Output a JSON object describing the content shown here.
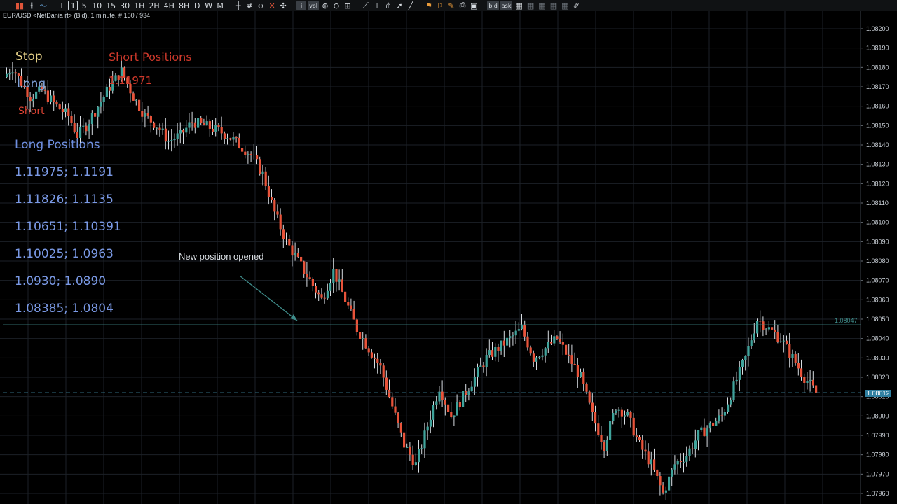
{
  "toolbar": {
    "group1": [
      {
        "name": "candlestick-icon",
        "glyph": "▮▮",
        "cls": "red"
      },
      {
        "name": "bar-chart-icon",
        "glyph": "⫲",
        "cls": ""
      },
      {
        "name": "line-chart-icon",
        "glyph": "〜",
        "cls": "blue"
      }
    ],
    "timeframes": [
      "T",
      "1",
      "5",
      "10",
      "15",
      "30",
      "1H",
      "2H",
      "4H",
      "8H",
      "D",
      "W",
      "M"
    ],
    "selected_timeframe": "1",
    "group2": [
      {
        "name": "crosshair-icon",
        "glyph": "┼",
        "cls": ""
      },
      {
        "name": "grid-icon",
        "glyph": "#",
        "cls": ""
      },
      {
        "name": "arrows-icon",
        "glyph": "↔",
        "cls": ""
      },
      {
        "name": "delete-icon",
        "glyph": "✕",
        "cls": "red"
      },
      {
        "name": "move-icon",
        "glyph": "✣",
        "cls": ""
      },
      {
        "name": "info-icon",
        "glyph": "i",
        "cls": "box"
      },
      {
        "name": "volume-icon",
        "glyph": "vol",
        "cls": "box"
      },
      {
        "name": "zoom-in-icon",
        "glyph": "⊕",
        "cls": ""
      },
      {
        "name": "zoom-out-icon",
        "glyph": "⊖",
        "cls": ""
      },
      {
        "name": "fit-icon",
        "glyph": "⊞",
        "cls": ""
      },
      {
        "name": "trend-tool-icon",
        "glyph": "⟋",
        "cls": ""
      },
      {
        "name": "fibonacci-icon",
        "glyph": "⊥",
        "cls": ""
      },
      {
        "name": "channel-icon",
        "glyph": "⫛",
        "cls": ""
      },
      {
        "name": "pointer-icon",
        "glyph": "➚",
        "cls": ""
      },
      {
        "name": "draw-line-icon",
        "glyph": "╱",
        "cls": ""
      },
      {
        "name": "flag-icon",
        "glyph": "⚑",
        "cls": "orange"
      },
      {
        "name": "marker-icon",
        "glyph": "⚐",
        "cls": "orange"
      },
      {
        "name": "pencil-icon",
        "glyph": "✎",
        "cls": "orange"
      },
      {
        "name": "print-icon",
        "glyph": "⎙",
        "cls": ""
      },
      {
        "name": "image-icon",
        "glyph": "▣",
        "cls": ""
      },
      {
        "name": "bid-icon",
        "glyph": "bid",
        "cls": "box"
      },
      {
        "name": "ask-icon",
        "glyph": "ask",
        "cls": "box"
      },
      {
        "name": "layout1-icon",
        "glyph": "▦",
        "cls": ""
      },
      {
        "name": "layout2-icon",
        "glyph": "▦",
        "cls": "dim"
      },
      {
        "name": "layout3-icon",
        "glyph": "▦",
        "cls": "dim"
      },
      {
        "name": "layout4-icon",
        "glyph": "▦",
        "cls": "dim"
      },
      {
        "name": "layout5-icon",
        "glyph": "▦",
        "cls": "dim"
      },
      {
        "name": "pin-icon",
        "glyph": "✐",
        "cls": ""
      }
    ]
  },
  "chart": {
    "symbol_label": "EUR/USD <NetDania rt> (Bid), 1 minute, # 150 / 934",
    "background": "#000000",
    "grid_color": "#1c2127",
    "up_color": "#3fa39b",
    "down_color": "#e8533a",
    "axis_text_color": "#c9cfd6",
    "y_ticks": [
      "1.08200",
      "1.08190",
      "1.08180",
      "1.08170",
      "1.08160",
      "1.08150",
      "1.08140",
      "1.08130",
      "1.08120",
      "1.08110",
      "1.08100",
      "1.08090",
      "1.08080",
      "1.08070",
      "1.08060",
      "1.08050",
      "1.08040",
      "1.08030",
      "1.08020",
      "1.08010",
      "1.08000",
      "1.07990",
      "1.07980",
      "1.07970",
      "1.07960"
    ],
    "solid_line_price_label": "1.08047",
    "dashed_line_price_label": "1.08012",
    "solid_line_color": "#3f8c8a",
    "dashed_line_color": "#3f8ca6"
  },
  "overlay": {
    "stop_label": "Stop",
    "long_label": "Long",
    "short_label": "Short",
    "short_positions_title": "Short Positions",
    "short_positions_values": [
      "1.11971"
    ],
    "long_positions_title": "Long Positions",
    "long_positions_values": [
      "1.11975; 1.1191",
      "1.11826; 1.1135",
      "1.10651; 1.10391",
      "1.10025; 1.0963",
      "1.0930; 1.0890",
      "1.08385; 1.0804"
    ],
    "annotation_text": "New position opened"
  }
}
